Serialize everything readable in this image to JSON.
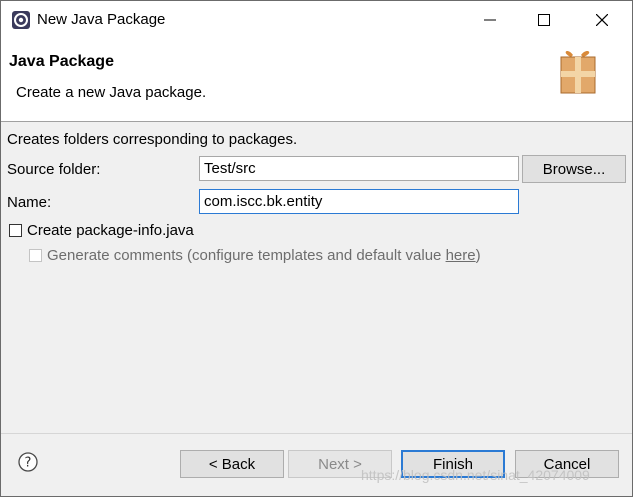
{
  "window": {
    "title": "New Java Package",
    "icon": "eclipse-icon"
  },
  "banner": {
    "title": "Java Package",
    "description": "Create a new Java package.",
    "image": "package-wizard-icon"
  },
  "form": {
    "intro": "Creates folders corresponding to packages.",
    "source_folder_label": "Source folder:",
    "source_folder_value": "Test/src",
    "browse_label": "Browse...",
    "name_label": "Name:",
    "name_value": "com.iscc.bk.entity",
    "create_info_label": "Create package-info.java",
    "create_info_checked": false,
    "generate_comments_prefix": "Generate comments (configure templates and default value ",
    "generate_comments_link": "here",
    "generate_comments_suffix": ")",
    "generate_comments_checked": false
  },
  "buttons": {
    "back": "< Back",
    "next": "Next >",
    "finish": "Finish",
    "cancel": "Cancel"
  },
  "watermark": "https://blog.csdn.net/sinat_42074009",
  "colors": {
    "focus_border": "#2b7ad4",
    "window_bg": "#f0f0f0",
    "banner_bg": "#ffffff"
  }
}
